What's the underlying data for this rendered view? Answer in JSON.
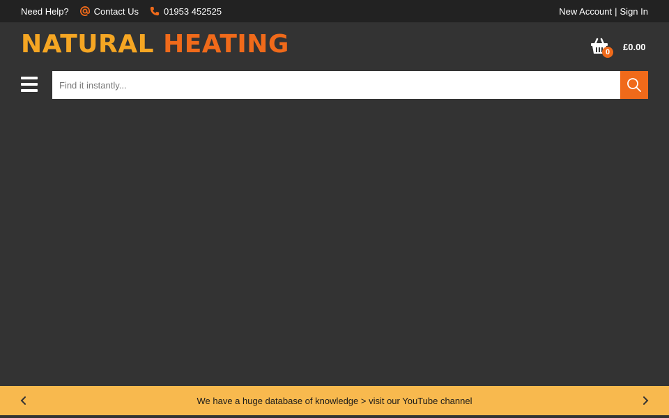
{
  "topbar": {
    "need_help": "Need Help?",
    "contact_label": "Contact Us",
    "phone": "01953 452525",
    "new_account": "New Account",
    "separator": "|",
    "sign_in": "Sign In"
  },
  "brand": {
    "word1": "NATURAL",
    "word2": "HEATING",
    "color_primary": "#f5a623",
    "color_accent": "#f06a1a"
  },
  "cart": {
    "count": "0",
    "total": "£0.00",
    "icon": "basket-icon"
  },
  "search": {
    "placeholder": "Find it instantly...",
    "icon": "search-icon"
  },
  "menu": {
    "icon": "hamburger-menu-icon"
  },
  "promo": {
    "message": "We have a huge database of knowledge > visit our YouTube channel",
    "background": "#f8b94e"
  }
}
